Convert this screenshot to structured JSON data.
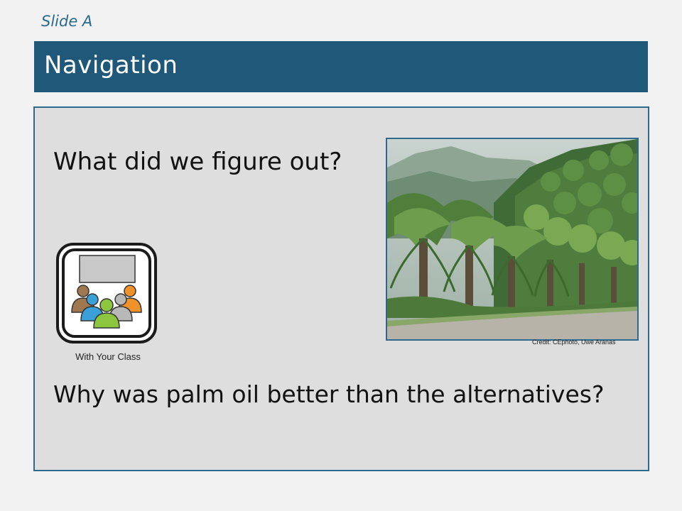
{
  "slide": {
    "label": "Slide A",
    "title": "Navigation"
  },
  "content": {
    "question_1": "What did we figure out?",
    "question_2": "Why was palm oil better than the alternatives?",
    "class_icon": {
      "icon": "with-your-class-icon",
      "caption": "With Your Class"
    },
    "photo": {
      "credit": "Credit: CEphoto, Uwe Aranas"
    }
  },
  "colors": {
    "title_bar": "#1f5878",
    "border": "#2e6a8e",
    "content_bg": "#dedede",
    "page_bg": "#f2f2f2"
  }
}
